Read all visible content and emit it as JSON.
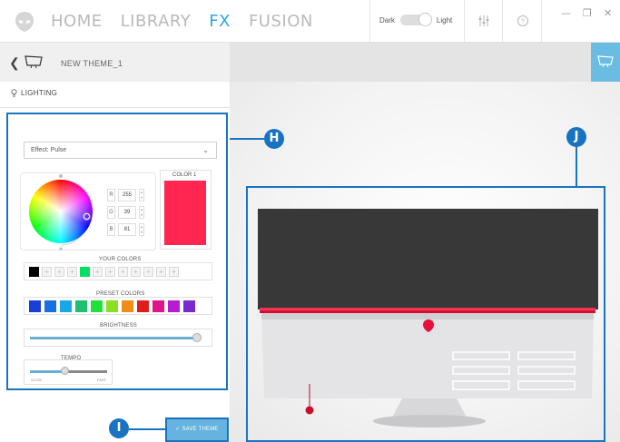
{
  "nav": {
    "items": [
      {
        "label": "HOME",
        "active": false
      },
      {
        "label": "LIBRARY",
        "active": false
      },
      {
        "label": "FX",
        "active": true
      },
      {
        "label": "FUSION",
        "active": false
      }
    ],
    "accent_color": "#2aa7df"
  },
  "theme_toggle": {
    "dark_label": "Dark",
    "light_label": "Light",
    "selected": "Light"
  },
  "toolbar": {
    "mixer_icon": "sliders-icon",
    "help_icon": "help-icon"
  },
  "window_controls": {
    "minimize": "—",
    "restore": "❐",
    "close": "✕"
  },
  "subbar": {
    "theme_name": "NEW THEME_1",
    "back_icon": "chevron-left-icon",
    "device_icon": "monitor-icon"
  },
  "lighting": {
    "tab_label": "LIGHTING",
    "effect": "Effect: Pulse",
    "rgb": {
      "r_label": "R",
      "r": "255",
      "g_label": "G",
      "g": "39",
      "b_label": "B",
      "b": "81"
    },
    "color1_label": "COLOR 1",
    "color1_hex": "#ff2751",
    "your_colors_label": "YOUR COLORS",
    "your_colors": [
      "#000000",
      "",
      "",
      "",
      "#00e060",
      "",
      "",
      "",
      "",
      "",
      "",
      ""
    ],
    "preset_colors_label": "PRESET COLORS",
    "preset_colors": [
      "#1a3fd8",
      "#1a6fe0",
      "#18a8e8",
      "#1cc070",
      "#22e03a",
      "#8ae020",
      "#f08c18",
      "#e01c1c",
      "#e0148c",
      "#b81cd0",
      "#7a28d0"
    ],
    "brightness_label": "BRIGHTNESS",
    "brightness_value": 0.97,
    "tempo_label": "TEMPO",
    "tempo_slow": "SLOW",
    "tempo_fast": "FAST",
    "tempo_value": 0.45
  },
  "save_button": "✓ SAVE THEME",
  "callouts": {
    "h": "H",
    "i": "I",
    "j": "J"
  },
  "colors": {
    "callout": "#1a73c2",
    "monitor_led": "#e8103a"
  }
}
